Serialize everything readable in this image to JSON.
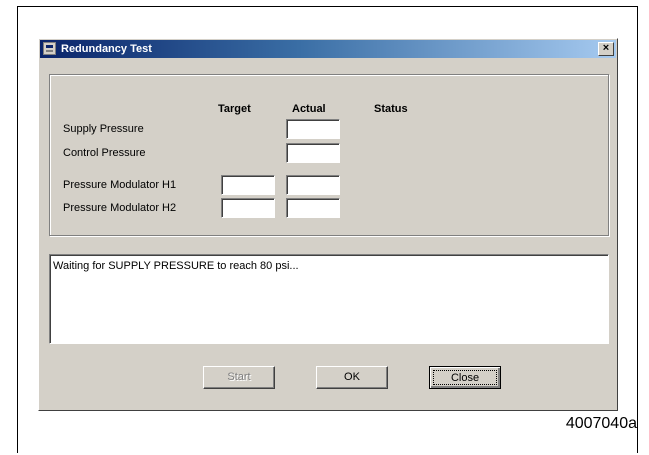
{
  "window": {
    "title": "Redundancy Test",
    "close_glyph": "×"
  },
  "columns": {
    "target": "Target",
    "actual": "Actual",
    "status": "Status"
  },
  "rows": [
    {
      "label": "Supply Pressure",
      "target": null,
      "actual": ""
    },
    {
      "label": "Control Pressure",
      "target": null,
      "actual": ""
    },
    {
      "label": "Pressure Modulator H1",
      "target": "",
      "actual": ""
    },
    {
      "label": "Pressure Modulator H2",
      "target": "",
      "actual": ""
    }
  ],
  "log": {
    "message": "Waiting for SUPPLY PRESSURE to reach 80 psi..."
  },
  "buttons": {
    "start": {
      "label": "Start",
      "enabled": false
    },
    "ok": {
      "label": "OK",
      "enabled": true
    },
    "close": {
      "label": "Close",
      "enabled": true,
      "default": true
    }
  },
  "figure_code": "4007040a",
  "colors": {
    "face": "#d4d0c8",
    "title_start": "#0a246a",
    "title_end": "#a6caf0"
  }
}
